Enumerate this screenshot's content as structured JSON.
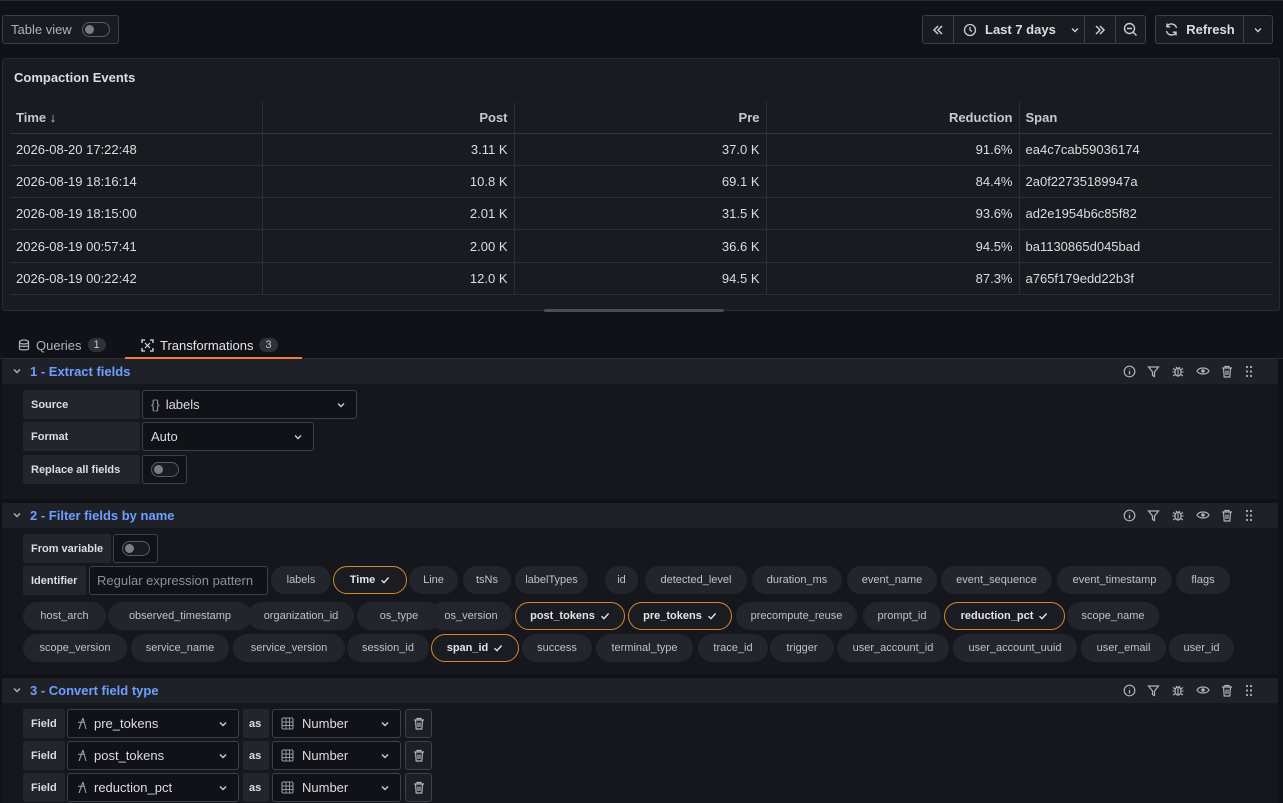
{
  "toolbar": {
    "table_view_label": "Table view",
    "time_range_label": "Last 7 days",
    "refresh_label": "Refresh"
  },
  "panel": {
    "title": "Compaction Events",
    "columns": [
      "Time",
      "Post",
      "Pre",
      "Reduction",
      "Span"
    ],
    "sort_indicator": "↓",
    "rows": [
      [
        "2026-08-20 17:22:48",
        "3.11 K",
        "37.0 K",
        "91.6%",
        "ea4c7cab59036174"
      ],
      [
        "2026-08-19 18:16:14",
        "10.8 K",
        "69.1 K",
        "84.4%",
        "2a0f22735189947a"
      ],
      [
        "2026-08-19 18:15:00",
        "2.01 K",
        "31.5 K",
        "93.6%",
        "ad2e1954b6c85f82"
      ],
      [
        "2026-08-19 00:57:41",
        "2.00 K",
        "36.6 K",
        "94.5%",
        "ba1130865d045bad"
      ],
      [
        "2026-08-19 00:22:42",
        "12.0 K",
        "94.5 K",
        "87.3%",
        "a765f179edd22b3f"
      ]
    ]
  },
  "tabs": {
    "queries_label": "Queries",
    "queries_count": "1",
    "transformations_label": "Transformations",
    "transformations_count": "3"
  },
  "t1": {
    "title": "1 - Extract fields",
    "source_label": "Source",
    "source_value": "labels",
    "format_label": "Format",
    "format_value": "Auto",
    "replace_label": "Replace all fields"
  },
  "t2": {
    "title": "2 - Filter fields by name",
    "from_variable_label": "From variable",
    "identifier_label": "Identifier",
    "pattern_placeholder": "Regular expression pattern",
    "fields": [
      "labels",
      "Time",
      "Line",
      "tsNs",
      "labelTypes",
      "id",
      "detected_level",
      "duration_ms",
      "event_name",
      "event_sequence",
      "event_timestamp",
      "flags",
      "host_arch",
      "observed_timestamp",
      "organization_id",
      "os_type",
      "os_version",
      "post_tokens",
      "pre_tokens",
      "precompute_reuse",
      "prompt_id",
      "reduction_pct",
      "scope_name",
      "scope_version",
      "service_name",
      "service_version",
      "session_id",
      "span_id",
      "success",
      "terminal_type",
      "trace_id",
      "trigger",
      "user_account_id",
      "user_account_uuid",
      "user_email",
      "user_id"
    ],
    "selected_fields": [
      "Time",
      "post_tokens",
      "pre_tokens",
      "reduction_pct",
      "span_id"
    ]
  },
  "t3": {
    "title": "3 - Convert field type",
    "field_label": "Field",
    "as_label": "as",
    "conversions": [
      {
        "field": "pre_tokens",
        "type": "Number"
      },
      {
        "field": "post_tokens",
        "type": "Number"
      },
      {
        "field": "reduction_pct",
        "type": "Number"
      }
    ]
  },
  "colors": {
    "accent_blue": "#6e9fff",
    "selected_chip_border": "#d2892f",
    "active_tab_underline": "#f27a3d"
  }
}
